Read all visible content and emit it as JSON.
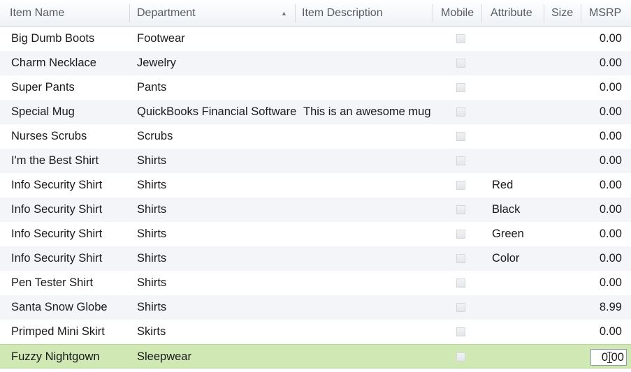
{
  "grid": {
    "columns": [
      {
        "key": "name",
        "label": "Item Name"
      },
      {
        "key": "department",
        "label": "Department"
      },
      {
        "key": "description",
        "label": "Item Description"
      },
      {
        "key": "mobile",
        "label": "Mobile"
      },
      {
        "key": "attribute",
        "label": "Attribute"
      },
      {
        "key": "size",
        "label": "Size"
      },
      {
        "key": "msrp",
        "label": "MSRP"
      }
    ],
    "sort": {
      "column": "department",
      "direction": "ascending",
      "icon": "sort-ascending-icon"
    },
    "rows": [
      {
        "name": "Big Dumb Boots",
        "department": "Footwear",
        "description": "",
        "attribute": "",
        "size": "",
        "msrp": "0.00",
        "mobile": false
      },
      {
        "name": "Charm Necklace",
        "department": "Jewelry",
        "description": "",
        "attribute": "",
        "size": "",
        "msrp": "0.00",
        "mobile": false
      },
      {
        "name": "Super Pants",
        "department": "Pants",
        "description": "",
        "attribute": "",
        "size": "",
        "msrp": "0.00",
        "mobile": false
      },
      {
        "name": "Special Mug",
        "department": "QuickBooks Financial Software",
        "description": "This is an awesome mug",
        "attribute": "",
        "size": "",
        "msrp": "0.00",
        "mobile": false
      },
      {
        "name": "Nurses Scrubs",
        "department": "Scrubs",
        "description": "",
        "attribute": "",
        "size": "",
        "msrp": "0.00",
        "mobile": false
      },
      {
        "name": "I'm the Best Shirt",
        "department": "Shirts",
        "description": "",
        "attribute": "",
        "size": "",
        "msrp": "0.00",
        "mobile": false
      },
      {
        "name": "Info Security Shirt",
        "department": "Shirts",
        "description": "",
        "attribute": "Red",
        "size": "",
        "msrp": "0.00",
        "mobile": false
      },
      {
        "name": "Info Security Shirt",
        "department": "Shirts",
        "description": "",
        "attribute": "Black",
        "size": "",
        "msrp": "0.00",
        "mobile": false
      },
      {
        "name": "Info Security Shirt",
        "department": "Shirts",
        "description": "",
        "attribute": "Green",
        "size": "",
        "msrp": "0.00",
        "mobile": false
      },
      {
        "name": "Info Security Shirt",
        "department": "Shirts",
        "description": "",
        "attribute": "Color",
        "size": "",
        "msrp": "0.00",
        "mobile": false
      },
      {
        "name": "Pen Tester Shirt",
        "department": "Shirts",
        "description": "",
        "attribute": "",
        "size": "",
        "msrp": "0.00",
        "mobile": false
      },
      {
        "name": "Santa Snow Globe",
        "department": "Shirts",
        "description": "",
        "attribute": "",
        "size": "",
        "msrp": "8.99",
        "mobile": false
      },
      {
        "name": "Primped Mini Skirt",
        "department": "Skirts",
        "description": "",
        "attribute": "",
        "size": "",
        "msrp": "0.00",
        "mobile": false
      },
      {
        "name": "Fuzzy Nightgown",
        "department": "Sleepwear",
        "description": "",
        "attribute": "",
        "size": "",
        "msrp": "0.00",
        "mobile": false,
        "selected": true,
        "editing": "msrp"
      }
    ]
  },
  "colors": {
    "selected_row": "#cfe8b4",
    "alt_row": "#f3f5f9",
    "header_text": "#555c66"
  }
}
